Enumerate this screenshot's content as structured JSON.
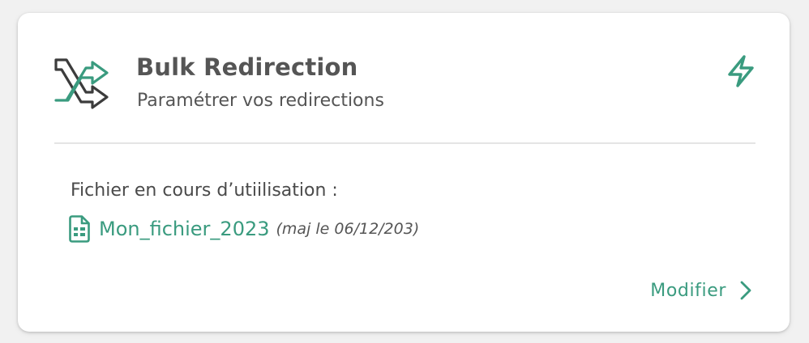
{
  "card": {
    "title": "Bulk Redirection",
    "subtitle": "Paramétrer vos redirections",
    "header_icon": "shuffle-arrows-icon",
    "action_icon": "lightning-bolt-icon"
  },
  "file": {
    "label": "Fichier en cours d’utiilisation :",
    "icon": "spreadsheet-file-icon",
    "name": "Mon_fichier_2023",
    "updated": "(maj le 06/12/203)"
  },
  "footer": {
    "modify_label": "Modifier",
    "modify_icon": "chevron-right-icon"
  },
  "colors": {
    "accent": "#3a9b7f",
    "text": "#555555",
    "icon_dark": "#3c3c3c"
  }
}
